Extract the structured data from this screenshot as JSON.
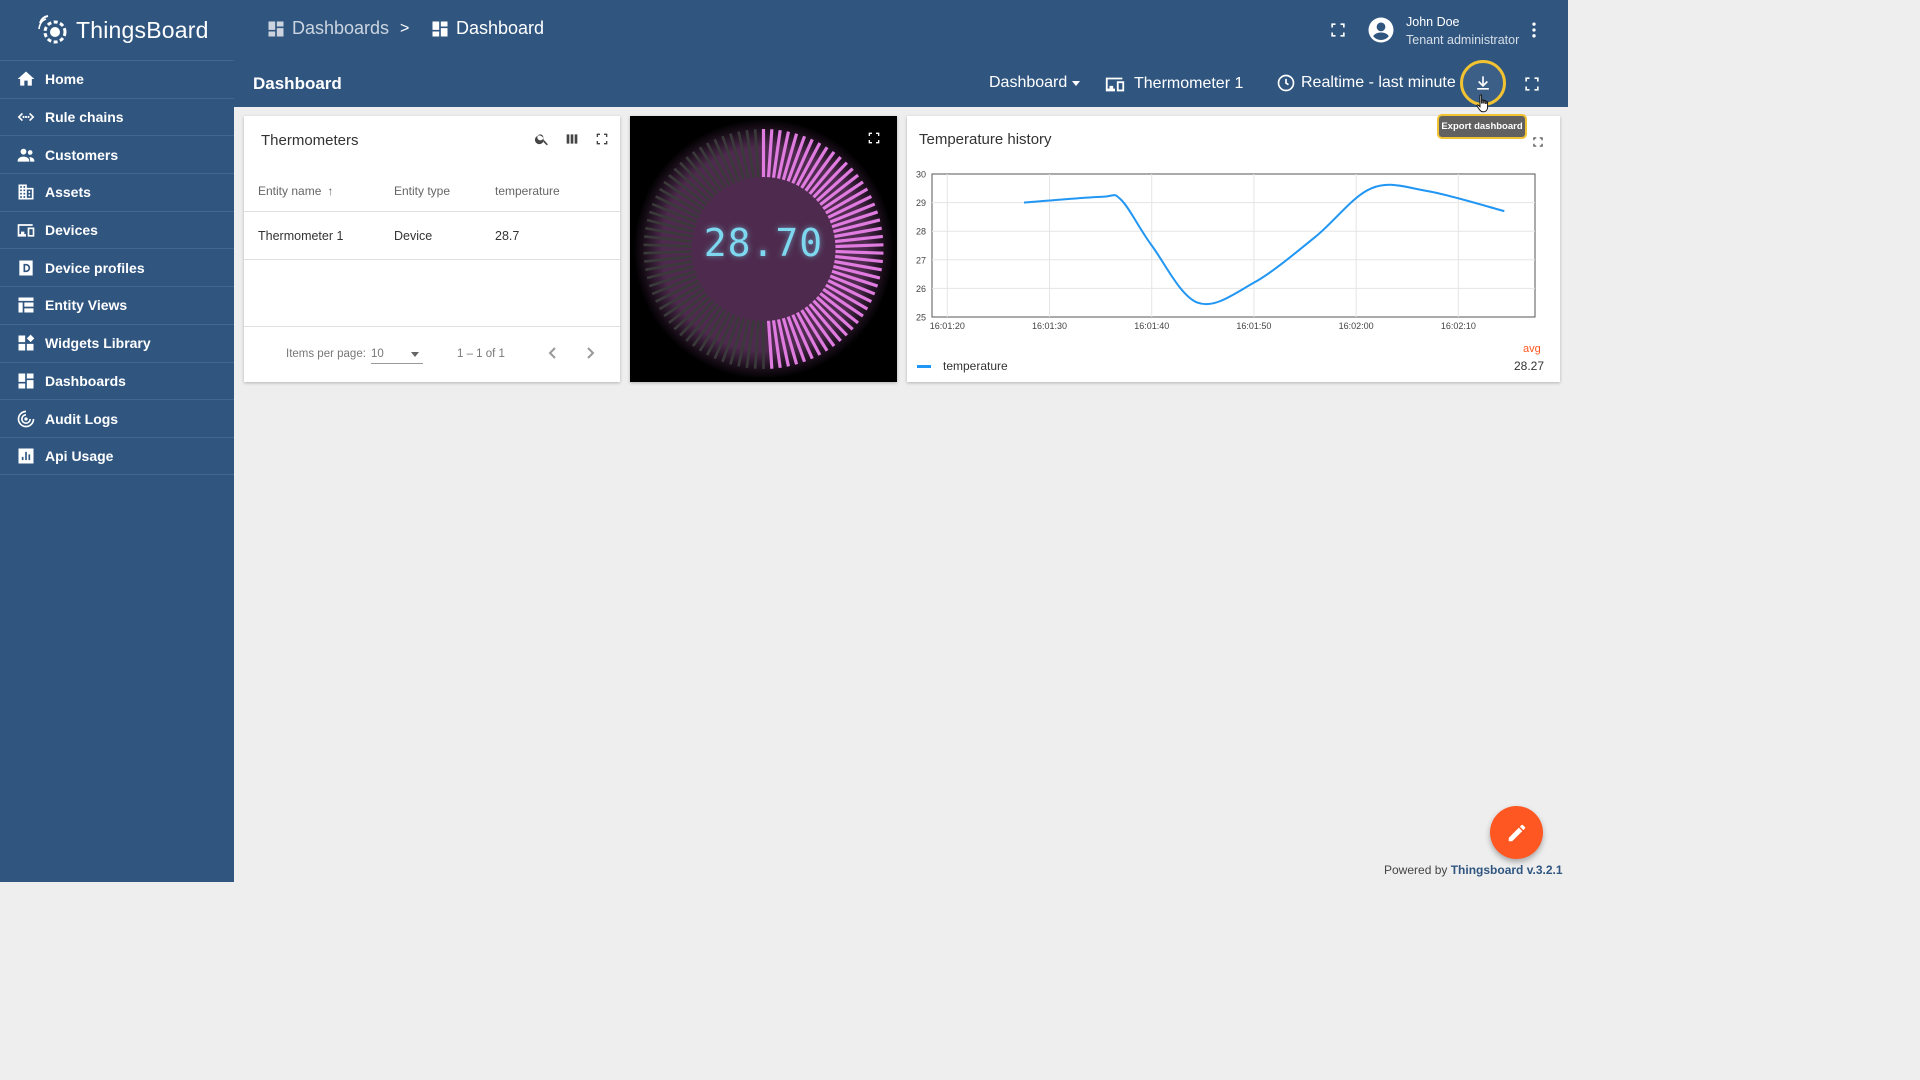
{
  "app": {
    "name": "ThingsBoard"
  },
  "sidebar": {
    "items": [
      {
        "label": "Home",
        "icon": "home-icon"
      },
      {
        "label": "Rule chains",
        "icon": "rule-chains-icon"
      },
      {
        "label": "Customers",
        "icon": "customers-icon"
      },
      {
        "label": "Assets",
        "icon": "assets-icon"
      },
      {
        "label": "Devices",
        "icon": "devices-icon"
      },
      {
        "label": "Device profiles",
        "icon": "device-profiles-icon"
      },
      {
        "label": "Entity Views",
        "icon": "entity-views-icon"
      },
      {
        "label": "Widgets Library",
        "icon": "widgets-library-icon"
      },
      {
        "label": "Dashboards",
        "icon": "dashboards-icon"
      },
      {
        "label": "Audit Logs",
        "icon": "audit-logs-icon"
      },
      {
        "label": "Api Usage",
        "icon": "api-usage-icon"
      }
    ]
  },
  "header": {
    "breadcrumb": [
      {
        "label": "Dashboards"
      },
      {
        "label": "Dashboard"
      }
    ],
    "separator": ">",
    "user": {
      "name": "John Doe",
      "role": "Tenant administrator"
    }
  },
  "toolbar": {
    "title": "Dashboard",
    "state_select": "Dashboard",
    "entity": "Thermometer 1",
    "timewindow": "Realtime - last minute",
    "export_tooltip": "Export dashboard"
  },
  "table_widget": {
    "title": "Thermometers",
    "columns": [
      "Entity name",
      "Entity type",
      "temperature"
    ],
    "sort_arrow": "↑",
    "rows": [
      [
        "Thermometer 1",
        "Device",
        "28.7"
      ]
    ],
    "items_per_page_label": "Items per page:",
    "items_per_page": "10",
    "range": "1 – 1 of 1"
  },
  "gauge_widget": {
    "value": "28.70",
    "fraction": 0.5
  },
  "chart_widget": {
    "title": "Temperature history",
    "legend": {
      "header": "avg",
      "series": "temperature",
      "value": "28.27"
    }
  },
  "chart_data": {
    "type": "line",
    "title": "Temperature history",
    "xlabel": "",
    "ylabel": "",
    "ylim": [
      25,
      30
    ],
    "yticks": [
      "25",
      "26",
      "27",
      "28",
      "29",
      "30"
    ],
    "xticks": [
      "16:01:20",
      "16:01:30",
      "16:01:40",
      "16:01:50",
      "16:02:00",
      "16:02:10"
    ],
    "grid": true,
    "legend_position": "bottom",
    "series": [
      {
        "name": "temperature",
        "color": "#2196f3",
        "x": [
          "16:01:27.5",
          "16:01:35",
          "16:01:37",
          "16:01:40",
          "16:01:44.5",
          "16:01:50",
          "16:01:56",
          "16:02:01.5",
          "16:02:07",
          "16:02:14.5"
        ],
        "y": [
          29.0,
          29.2,
          29.1,
          27.5,
          25.5,
          26.2,
          27.8,
          29.5,
          29.4,
          28.7
        ]
      }
    ]
  },
  "footer": {
    "powered_by": "Powered by",
    "link": "Thingsboard v.3.2.1"
  },
  "colors": {
    "primary": "#305680",
    "accent": "#ff5722",
    "highlight": "#f1c232",
    "series": "#2196f3",
    "gauge": "#e07be0"
  }
}
